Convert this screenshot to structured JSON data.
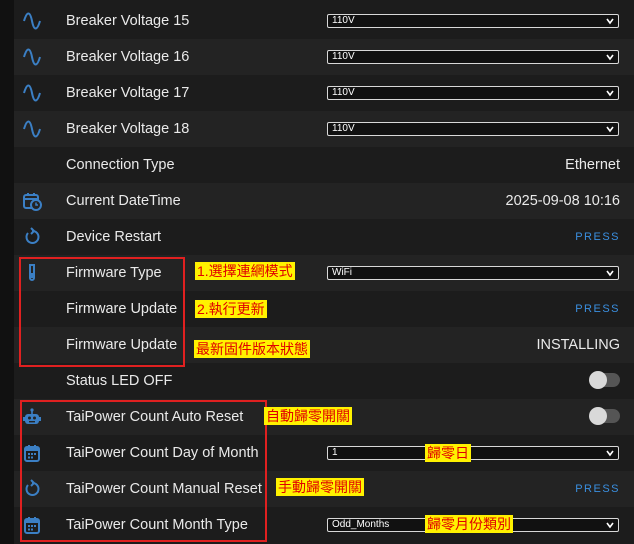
{
  "rows": [
    {
      "label": "Breaker Voltage 15",
      "icon": "sine-wave-icon",
      "select": "110V"
    },
    {
      "label": "Breaker Voltage 16",
      "icon": "sine-wave-icon",
      "select": "110V"
    },
    {
      "label": "Breaker Voltage 17",
      "icon": "sine-wave-icon",
      "select": "110V"
    },
    {
      "label": "Breaker Voltage 18",
      "icon": "sine-wave-icon",
      "select": "110V"
    },
    {
      "label": "Connection Type",
      "value": "Ethernet"
    },
    {
      "label": "Current DateTime",
      "icon": "calendar-clock-icon",
      "value": "2025-09-08 10:16"
    },
    {
      "label": "Device Restart",
      "icon": "restart-icon",
      "action": "PRESS"
    },
    {
      "label": "Firmware Type",
      "icon": "flask-icon",
      "select": "WiFi"
    },
    {
      "label": "Firmware Update",
      "action": "PRESS"
    },
    {
      "label": "Firmware Update",
      "value": "INSTALLING"
    },
    {
      "label": "Status LED OFF",
      "toggle": "off"
    },
    {
      "label": "TaiPower Count Auto Reset",
      "icon": "robot-icon",
      "toggle": "off"
    },
    {
      "label": "TaiPower Count Day of Month",
      "icon": "calendar-icon",
      "select": "1"
    },
    {
      "label": "TaiPower Count Manual Reset",
      "icon": "restart-icon",
      "action": "PRESS"
    },
    {
      "label": "TaiPower Count Month Type",
      "icon": "calendar-icon",
      "select": "Odd_Months"
    }
  ],
  "annotations": {
    "firmware_type": "1.選擇連網模式",
    "firmware_update": "2.執行更新",
    "firmware_status": "最新固件版本狀態",
    "auto_reset": "自動歸零開關",
    "day_of_month": "歸零日",
    "manual_reset": "手動歸零開關",
    "month_type": "歸零月份類別"
  },
  "colors": {
    "accent": "#3a8fe0",
    "icon": "#3b7fc4",
    "annotation_bg": "#fff200",
    "annotation_text": "#e00000",
    "highlight_box": "#e02020"
  }
}
